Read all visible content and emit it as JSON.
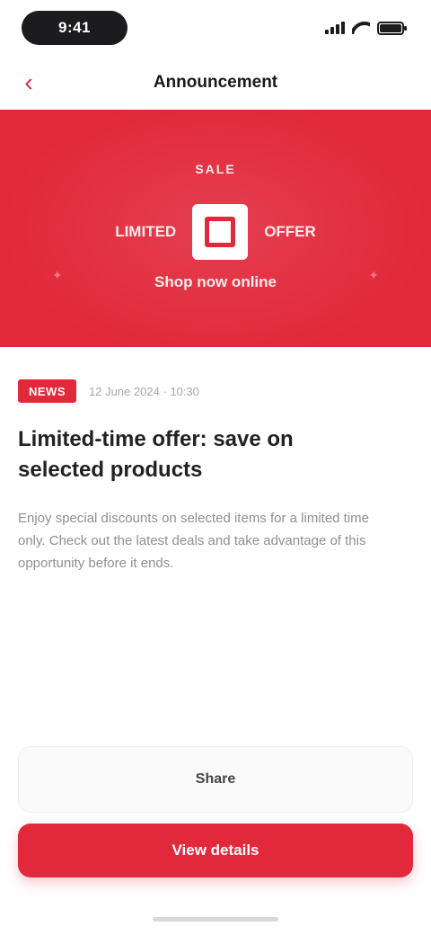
{
  "status_bar": {
    "time": "9:41"
  },
  "nav": {
    "title": "Announcement",
    "back_icon": "chevron-left-icon"
  },
  "hero": {
    "top_text": "SALE",
    "side_left": "LIMITED",
    "side_right": "OFFER",
    "bottom_text": "Shop now online",
    "corner_left": "✦",
    "corner_right": "✦",
    "background_color": "#e1293b"
  },
  "article": {
    "tag": "NEWS",
    "date": "12 June 2024 · 10:30",
    "title": "Limited-time offer: save on selected products",
    "body": "Enjoy special discounts on selected items for a limited time only. Check out the latest deals and take advantage of this opportunity before it ends."
  },
  "actions": {
    "secondary_label": "Share",
    "primary_label": "View details"
  },
  "colors": {
    "accent": "#e1293b",
    "text": "#222222",
    "muted": "#8f8f95"
  }
}
